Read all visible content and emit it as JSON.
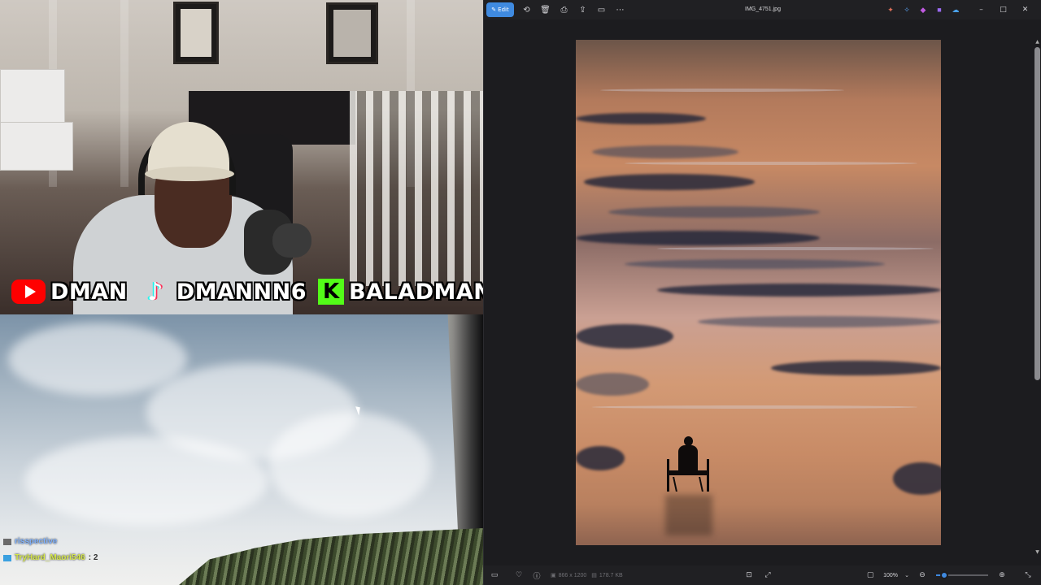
{
  "stream": {
    "socials": [
      {
        "platform_icon": "youtube-icon",
        "handle": "DMAN"
      },
      {
        "platform_icon": "tiktok-icon",
        "handle": "DMANNN6"
      },
      {
        "platform_icon": "kick-icon",
        "handle": "BALADMAN"
      }
    ],
    "chat": [
      {
        "user": "risspective",
        "message": ""
      },
      {
        "user": "TryHard_Maori546",
        "message": ": 2"
      }
    ],
    "tiktok_glyph": "♪",
    "kick_glyph": "K"
  },
  "viewer": {
    "title": "IMG_4751.jpg",
    "toolbar": {
      "edit_label": "Edit",
      "edit_icon": "pencil-icon",
      "icons": [
        "rotate-icon",
        "delete-icon",
        "print-icon",
        "share-icon",
        "slideshow-icon",
        "more-icon"
      ]
    },
    "titlebar_apps": [
      "copilot-icon",
      "image-creator-icon",
      "paint-icon",
      "clipchamp-icon",
      "onedrive-icon"
    ],
    "window_controls": {
      "minimize": "–",
      "maximize": "□",
      "close": "✕"
    },
    "status": {
      "dimensions": "866 x 1200",
      "file_size": "178.7 KB",
      "zoom": "100%",
      "zoom_level": 0.15
    },
    "accent_color": "#3f8ae0"
  }
}
